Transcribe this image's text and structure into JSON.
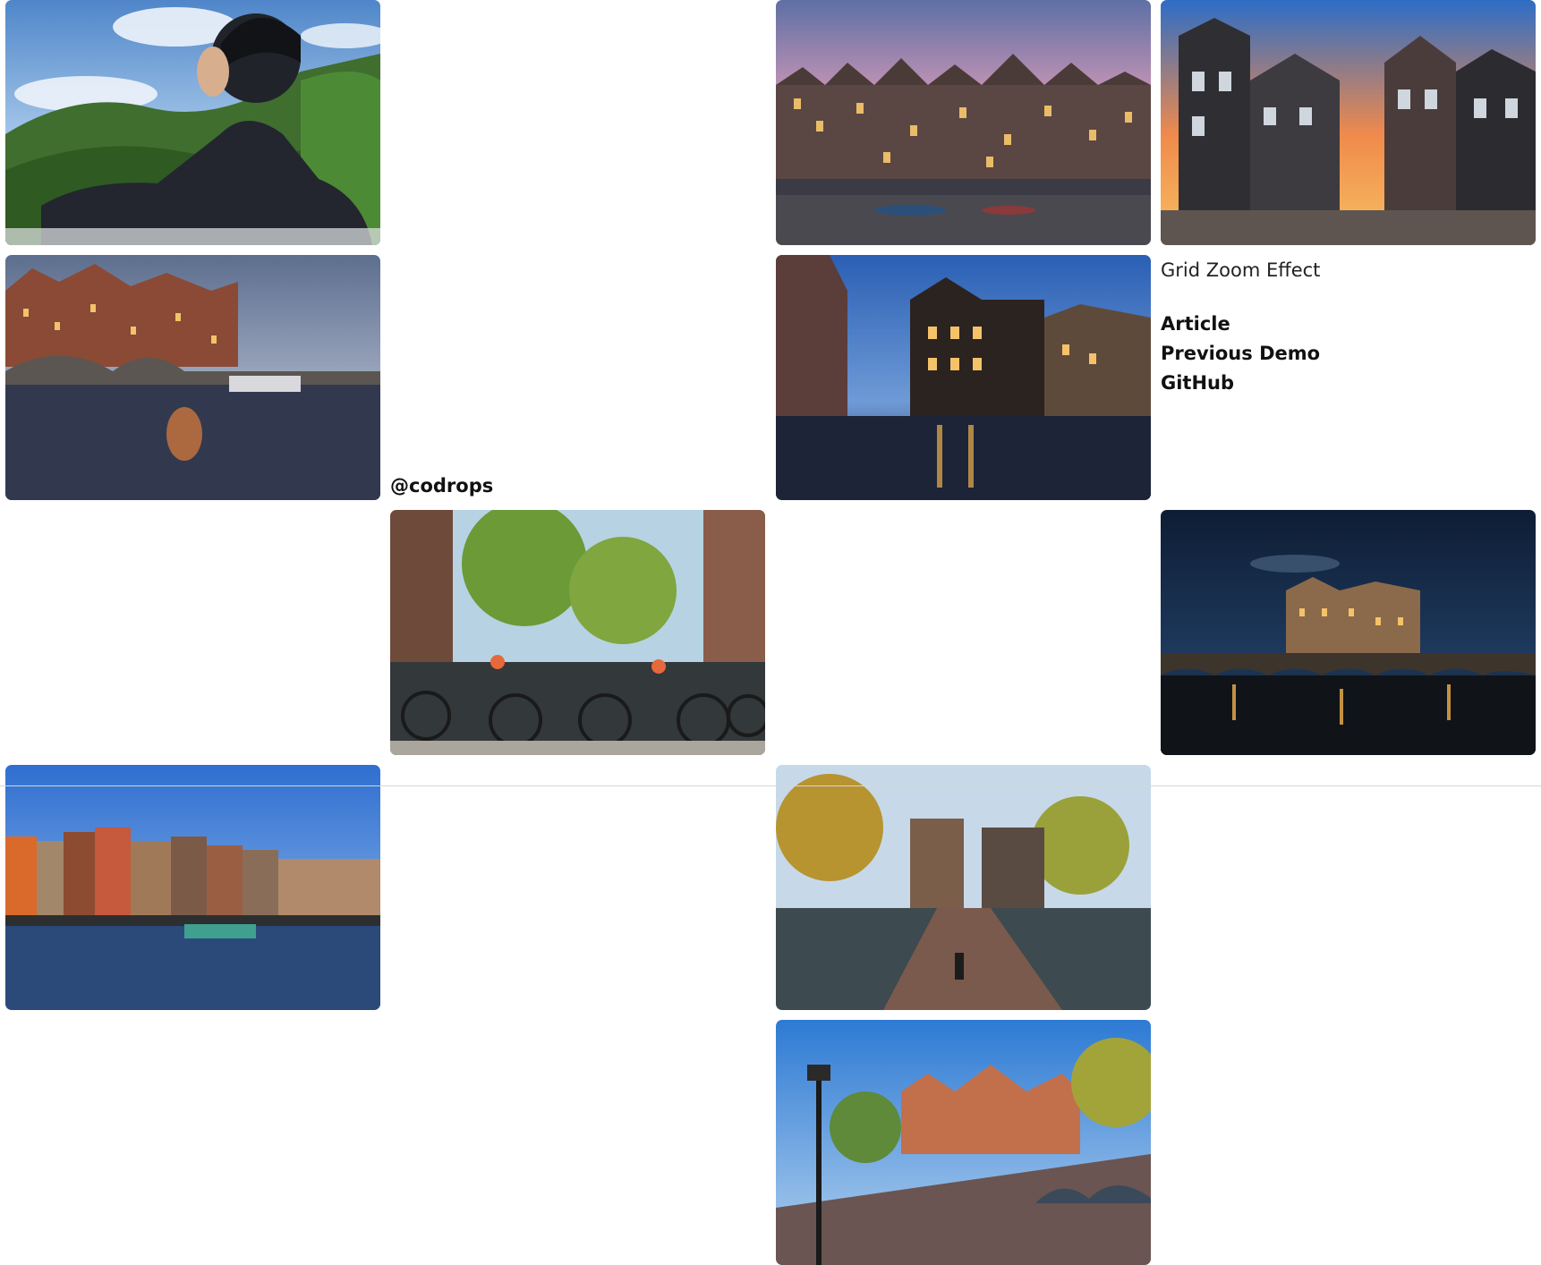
{
  "header": {
    "title": "Grid Zoom Effect",
    "links": [
      "Article",
      "Previous Demo",
      "GitHub"
    ],
    "credit": "@codrops"
  },
  "grid": {
    "images": [
      {
        "subject": "man in hoodie overlooking green mountains"
      },
      {
        "subject": "canal houses at pink sunset with boats"
      },
      {
        "subject": "gabled canal houses under orange sunset sky"
      },
      {
        "subject": "canal houses and bridge at dusk"
      },
      {
        "subject": "corner house on canal at blue hour"
      },
      {
        "subject": "bicycles on bridge railing with trees"
      },
      {
        "subject": "stone bridge and canal houses at night"
      },
      {
        "subject": "waterfront buildings under blue sky"
      },
      {
        "subject": "brick bridge with cyclist and autumn trees"
      },
      {
        "subject": "arched bridge with street lamp at evening"
      }
    ]
  },
  "colors": {
    "background": "#ffffff",
    "text": "#111111",
    "divider": "#d6d6d6"
  }
}
